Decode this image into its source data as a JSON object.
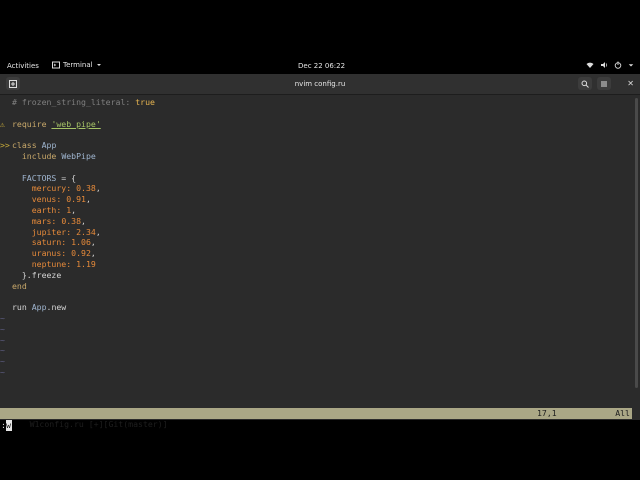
{
  "topbar": {
    "activities": "Activities",
    "app_name": "Terminal",
    "clock": "Dec 22  06:22",
    "icons": [
      "network-icon",
      "volume-icon",
      "power-icon"
    ]
  },
  "window": {
    "title": "nvim config.ru",
    "buttons": [
      "new-tab-icon",
      "search-icon",
      "menu-icon",
      "close-icon"
    ]
  },
  "editor": {
    "lines": [
      {
        "gutter": "",
        "parts": [
          [
            "comment",
            "# frozen_string_literal: "
          ],
          [
            "boolv",
            "true"
          ]
        ]
      },
      {
        "gutter": "",
        "parts": []
      },
      {
        "gutter": "⚠",
        "parts": [
          [
            "kw",
            "require"
          ],
          [
            "plain",
            " "
          ],
          [
            "str",
            "'web_pipe'"
          ]
        ]
      },
      {
        "gutter": "",
        "parts": []
      },
      {
        "gutter": ">>",
        "parts": [
          [
            "kw",
            "class"
          ],
          [
            "plain",
            " "
          ],
          [
            "const",
            "App"
          ]
        ]
      },
      {
        "gutter": "",
        "parts": [
          [
            "plain",
            "  "
          ],
          [
            "kw",
            "include"
          ],
          [
            "plain",
            " "
          ],
          [
            "const",
            "WebPipe"
          ]
        ]
      },
      {
        "gutter": "",
        "parts": []
      },
      {
        "gutter": "",
        "parts": [
          [
            "plain",
            "  "
          ],
          [
            "const",
            "FACTORS"
          ],
          [
            "plain",
            " = {"
          ]
        ]
      },
      {
        "gutter": "",
        "parts": [
          [
            "plain",
            "    "
          ],
          [
            "sym",
            "mercury:"
          ],
          [
            "plain",
            " "
          ],
          [
            "num",
            "0.38"
          ],
          [
            "plain",
            ","
          ]
        ]
      },
      {
        "gutter": "",
        "parts": [
          [
            "plain",
            "    "
          ],
          [
            "sym",
            "venus:"
          ],
          [
            "plain",
            " "
          ],
          [
            "num",
            "0.91"
          ],
          [
            "plain",
            ","
          ]
        ]
      },
      {
        "gutter": "",
        "parts": [
          [
            "plain",
            "    "
          ],
          [
            "sym",
            "earth:"
          ],
          [
            "plain",
            " "
          ],
          [
            "num",
            "1"
          ],
          [
            "plain",
            ","
          ]
        ]
      },
      {
        "gutter": "",
        "parts": [
          [
            "plain",
            "    "
          ],
          [
            "sym",
            "mars:"
          ],
          [
            "plain",
            " "
          ],
          [
            "num",
            "0.38"
          ],
          [
            "plain",
            ","
          ]
        ]
      },
      {
        "gutter": "",
        "parts": [
          [
            "plain",
            "    "
          ],
          [
            "sym",
            "jupiter:"
          ],
          [
            "plain",
            " "
          ],
          [
            "num",
            "2.34"
          ],
          [
            "plain",
            ","
          ]
        ]
      },
      {
        "gutter": "",
        "parts": [
          [
            "plain",
            "    "
          ],
          [
            "sym",
            "saturn:"
          ],
          [
            "plain",
            " "
          ],
          [
            "num",
            "1.06"
          ],
          [
            "plain",
            ","
          ]
        ]
      },
      {
        "gutter": "",
        "parts": [
          [
            "plain",
            "    "
          ],
          [
            "sym",
            "uranus:"
          ],
          [
            "plain",
            " "
          ],
          [
            "num",
            "0.92"
          ],
          [
            "plain",
            ","
          ]
        ]
      },
      {
        "gutter": "",
        "parts": [
          [
            "plain",
            "    "
          ],
          [
            "sym",
            "neptune:"
          ],
          [
            "plain",
            " "
          ],
          [
            "num",
            "1.19"
          ]
        ]
      },
      {
        "gutter": "",
        "parts": [
          [
            "plain",
            "  }."
          ],
          [
            "plain",
            "freeze"
          ]
        ]
      },
      {
        "gutter": "",
        "parts": [
          [
            "kw",
            "end"
          ]
        ]
      },
      {
        "gutter": "",
        "parts": []
      },
      {
        "gutter": "",
        "parts": [
          [
            "plain",
            "run "
          ],
          [
            "const",
            "App"
          ],
          [
            "plain",
            ".new"
          ]
        ]
      },
      {
        "gutter": "~",
        "parts": []
      },
      {
        "gutter": "~",
        "parts": []
      },
      {
        "gutter": "~",
        "parts": []
      },
      {
        "gutter": "~",
        "parts": []
      },
      {
        "gutter": "~",
        "parts": []
      },
      {
        "gutter": "~",
        "parts": []
      }
    ],
    "statusline_left": "W1config.ru [+][Git(master)]",
    "statusline_pos": "17,1",
    "statusline_scroll": "All",
    "cmdline_prefix": ":",
    "cmdline_cursor": "w"
  },
  "colors": {
    "background": "#2b2b2b",
    "statusline": "#aaa786"
  }
}
